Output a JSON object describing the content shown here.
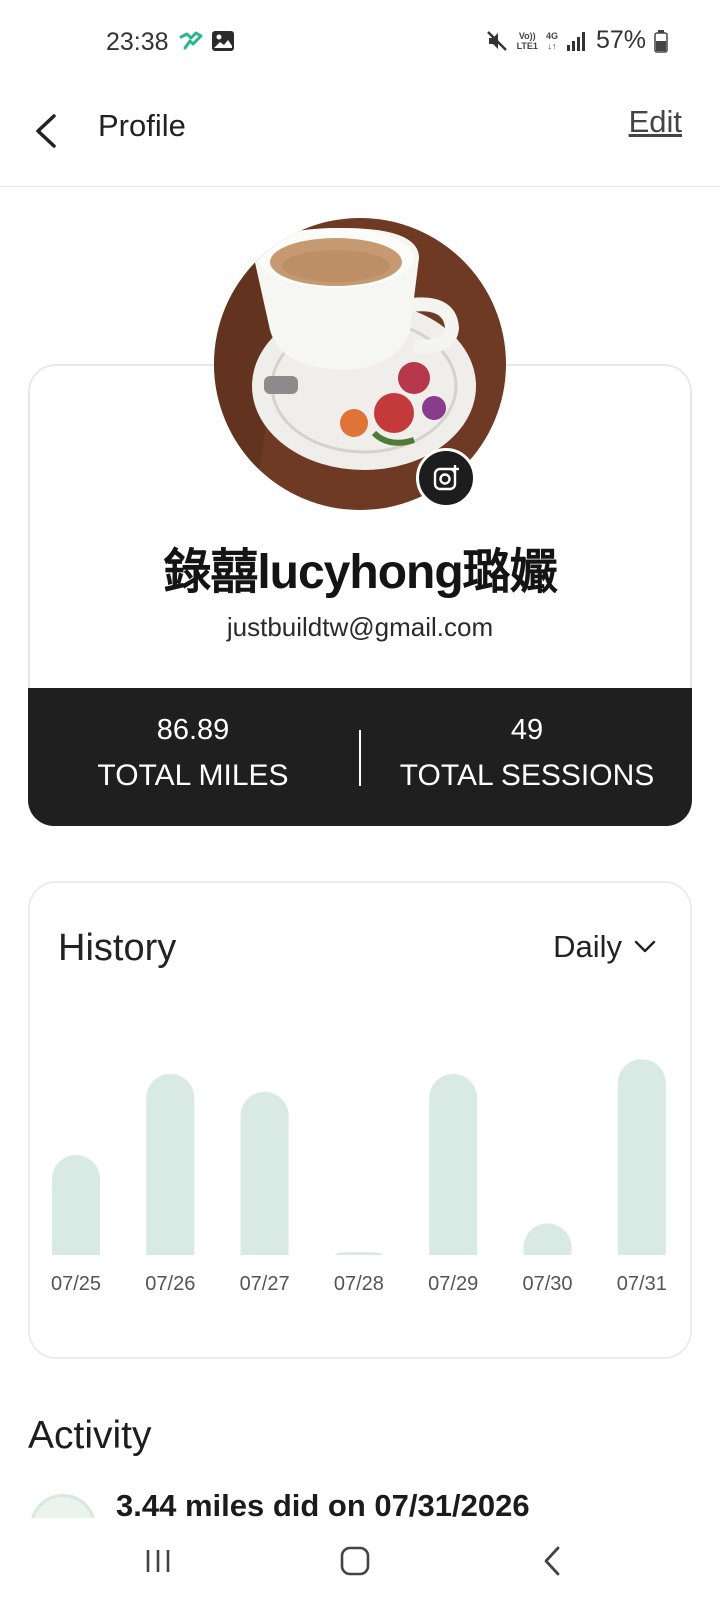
{
  "status_bar": {
    "time": "23:38",
    "network_top": "Vo))",
    "network_bottom": "LTE1",
    "data_type": "4G",
    "battery": "57%"
  },
  "header": {
    "title": "Profile",
    "edit_label": "Edit"
  },
  "profile": {
    "name": "錄囍lucyhong璐孍",
    "email": "justbuildtw@gmail.com",
    "total_miles_value": "86.89",
    "total_miles_label": "TOTAL MILES",
    "total_sessions_value": "49",
    "total_sessions_label": "TOTAL SESSIONS"
  },
  "history": {
    "title": "History",
    "period": "Daily"
  },
  "chart_data": {
    "type": "bar",
    "categories": [
      "07/25",
      "07/26",
      "07/27",
      "07/28",
      "07/29",
      "07/30",
      "07/31"
    ],
    "values": [
      1.9,
      3.44,
      3.1,
      0.06,
      3.44,
      0.6,
      3.72
    ],
    "ylim": [
      0,
      3.8
    ],
    "bar_color": "#d8eae3"
  },
  "activity": {
    "title": "Activity",
    "first_item": "3.44 miles did on 07/31/2026"
  },
  "colors": {
    "stats_background": "#1f1f1f",
    "bar_fill": "#d8eae3",
    "status_icon_green": "#2bb58a"
  },
  "icons": {
    "back": "chevron-left-icon",
    "camera": "camera-plus-icon",
    "dropdown": "chevron-down-icon",
    "nav_recents": "recents-icon",
    "nav_home": "home-icon",
    "nav_back": "back-icon"
  }
}
